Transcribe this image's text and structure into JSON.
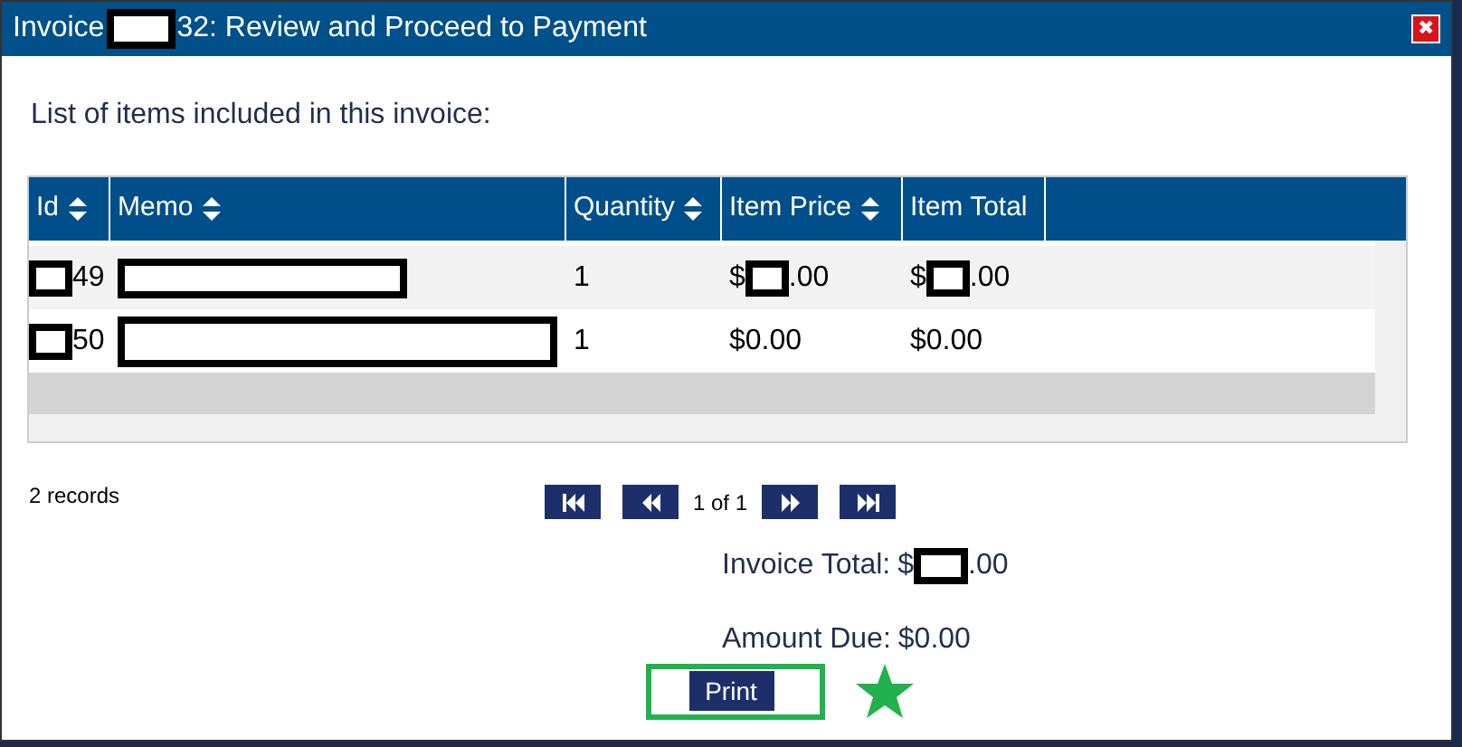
{
  "dialog": {
    "title": [
      {
        "kind": "text",
        "text": "Invoice"
      },
      {
        "kind": "redaction"
      },
      {
        "kind": "text",
        "text": "32: Review and Proceed to Payment"
      }
    ],
    "close": "✖"
  },
  "intro": "List of items included in this invoice:",
  "table": {
    "columns": [
      {
        "label": "Id",
        "sortable": true
      },
      {
        "label": "Memo",
        "sortable": true
      },
      {
        "label": "Quantity",
        "sortable": true
      },
      {
        "label": "Item Price",
        "sortable": true
      },
      {
        "label": "Item Total",
        "sortable": false
      }
    ],
    "rows": [
      {
        "cells": [
          [
            {
              "kind": "redaction"
            },
            {
              "kind": "text",
              "text": "49"
            }
          ],
          [
            {
              "kind": "redaction"
            }
          ],
          [
            {
              "kind": "text",
              "text": "1"
            }
          ],
          [
            {
              "kind": "text",
              "text": "$"
            },
            {
              "kind": "redaction"
            },
            {
              "kind": "text",
              "text": ".00"
            }
          ],
          [
            {
              "kind": "text",
              "text": "$"
            },
            {
              "kind": "redaction"
            },
            {
              "kind": "text",
              "text": ".00"
            }
          ]
        ]
      },
      {
        "cells": [
          [
            {
              "kind": "redaction"
            },
            {
              "kind": "text",
              "text": "50"
            }
          ],
          [
            {
              "kind": "redaction"
            }
          ],
          [
            {
              "kind": "text",
              "text": "1"
            }
          ],
          [
            {
              "kind": "text",
              "text": "$0.00"
            }
          ],
          [
            {
              "kind": "text",
              "text": "$0.00"
            }
          ]
        ]
      }
    ]
  },
  "records": "2 records",
  "pager": {
    "page": "1 of 1"
  },
  "totals": [
    {
      "label": "Invoice Total:",
      "value": [
        {
          "kind": "text",
          "text": "$"
        },
        {
          "kind": "redaction"
        },
        {
          "kind": "text",
          "text": ".00"
        }
      ]
    },
    {
      "label": "Amount Due:",
      "value": [
        {
          "kind": "text",
          "text": "$0.00"
        }
      ]
    }
  ],
  "print_button": "Print"
}
